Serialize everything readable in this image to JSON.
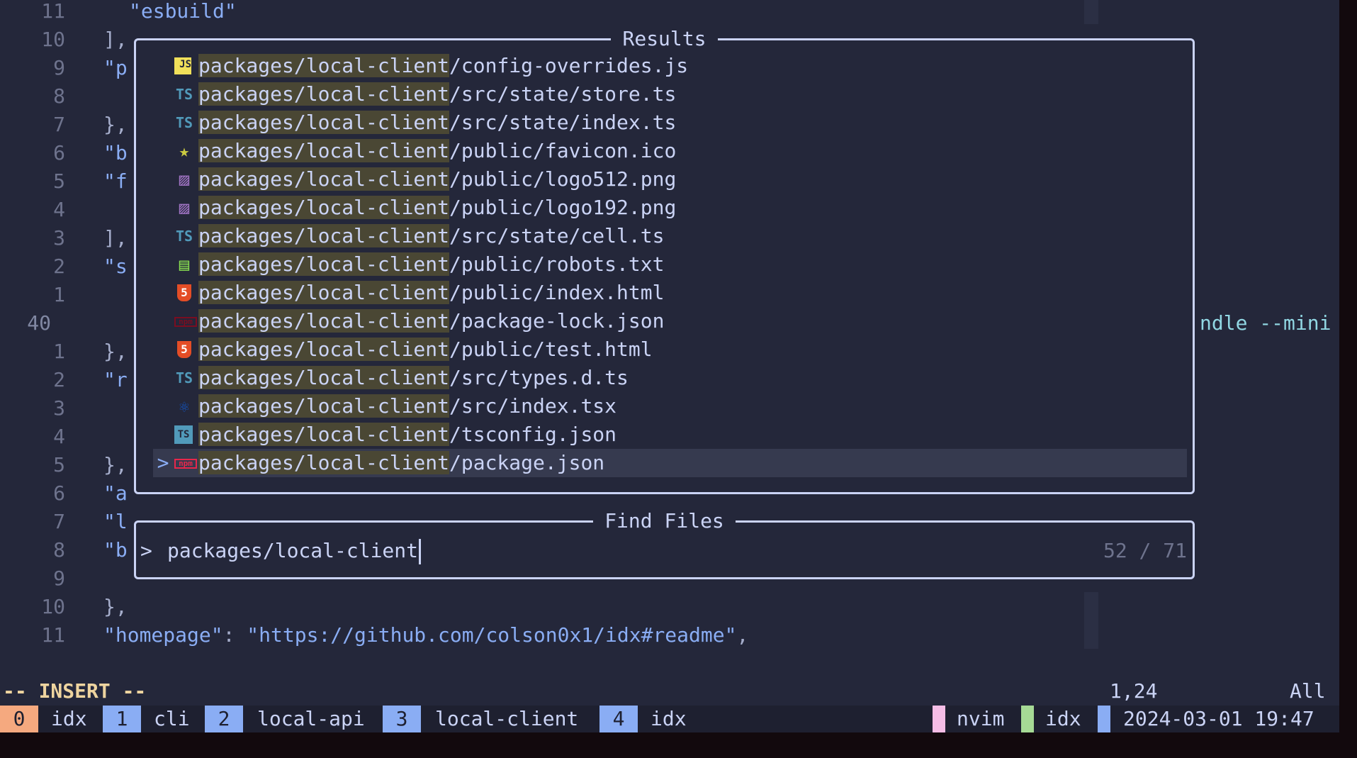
{
  "gutter": [
    "11",
    "10",
    "9",
    "8",
    "7",
    "6",
    "5",
    "4",
    "3",
    "2",
    "1",
    "40",
    "1",
    "2",
    "3",
    "4",
    "5",
    "6",
    "7",
    "8",
    "9",
    "10",
    "11"
  ],
  "code_fragments": {
    "line0": "\"esbuild\"",
    "line1": "],",
    "line2": "\"p",
    "line4": "},",
    "line5": "\"b",
    "line6": "\"f",
    "line8": "],",
    "line9": "\"s",
    "line12": "},",
    "line13": "\"r",
    "line16": "},",
    "line17": "\"a",
    "line18": "\"l",
    "line19": "\"b",
    "line21": "},",
    "line22_key": "\"homepage\"",
    "line22_sep": ": ",
    "line22_val": "\"https://github.com/colson0x1/idx#readme\"",
    "line22_end": ","
  },
  "wrap_tail": "ndle --mini",
  "results": {
    "title": "Results",
    "match_prefix": "packages/local-client",
    "selected_caret": ">",
    "items": [
      {
        "suffix": "/config-overrides.js",
        "icon": "javascript-file-icon",
        "glyph": "JS",
        "color": "#f1e05a"
      },
      {
        "suffix": "/src/state/store.ts",
        "icon": "typescript-file-icon",
        "glyph": "TS",
        "color": "#519aba"
      },
      {
        "suffix": "/src/state/index.ts",
        "icon": "typescript-file-icon",
        "glyph": "TS",
        "color": "#519aba"
      },
      {
        "suffix": "/public/favicon.ico",
        "icon": "star-icon",
        "glyph": "★",
        "color": "#cbcb41"
      },
      {
        "suffix": "/public/logo512.png",
        "icon": "image-file-icon",
        "glyph": "▨",
        "color": "#a074c4"
      },
      {
        "suffix": "/public/logo192.png",
        "icon": "image-file-icon",
        "glyph": "▨",
        "color": "#a074c4"
      },
      {
        "suffix": "/src/state/cell.ts",
        "icon": "typescript-file-icon",
        "glyph": "TS",
        "color": "#519aba"
      },
      {
        "suffix": "/public/robots.txt",
        "icon": "text-file-icon",
        "glyph": "▤",
        "color": "#89e051"
      },
      {
        "suffix": "/public/index.html",
        "icon": "html5-icon",
        "glyph": "5",
        "color": "#e44d26"
      },
      {
        "suffix": "/package-lock.json",
        "icon": "npm-lock-icon",
        "glyph": "npm",
        "color": "#7a0d21"
      },
      {
        "suffix": "/public/test.html",
        "icon": "html5-icon",
        "glyph": "5",
        "color": "#e44d26"
      },
      {
        "suffix": "/src/types.d.ts",
        "icon": "typescript-file-icon",
        "glyph": "TS",
        "color": "#519aba"
      },
      {
        "suffix": "/src/index.tsx",
        "icon": "react-icon",
        "glyph": "⚛",
        "color": "#1354bf"
      },
      {
        "suffix": "/tsconfig.json",
        "icon": "tsconfig-icon",
        "glyph": "TS",
        "color": "#519aba"
      },
      {
        "suffix": "/package.json",
        "icon": "npm-icon",
        "glyph": "npm",
        "color": "#e8274b"
      }
    ]
  },
  "find": {
    "title": "Find Files",
    "prompt": ">",
    "query": "packages/local-client",
    "count": "52 / 71"
  },
  "mode": {
    "text": "-- INSERT --",
    "cursor_pos": "1,24",
    "scroll": "All"
  },
  "tmux": {
    "windows": [
      {
        "index": "0",
        "name": "idx",
        "color": "#f5a97f"
      },
      {
        "index": "1",
        "name": "cli",
        "color": "#8aadf4"
      },
      {
        "index": "2",
        "name": "local-api",
        "color": "#8aadf4"
      },
      {
        "index": "3",
        "name": "local-client",
        "color": "#8aadf4"
      },
      {
        "index": "4",
        "name": "idx",
        "color": "#8aadf4"
      }
    ],
    "right": [
      {
        "text": "nvim",
        "color": "#f5bde6"
      },
      {
        "text": "idx",
        "color": "#a6da95"
      },
      {
        "text": "2024-03-01 19:47",
        "color": "#8aadf4"
      }
    ]
  }
}
